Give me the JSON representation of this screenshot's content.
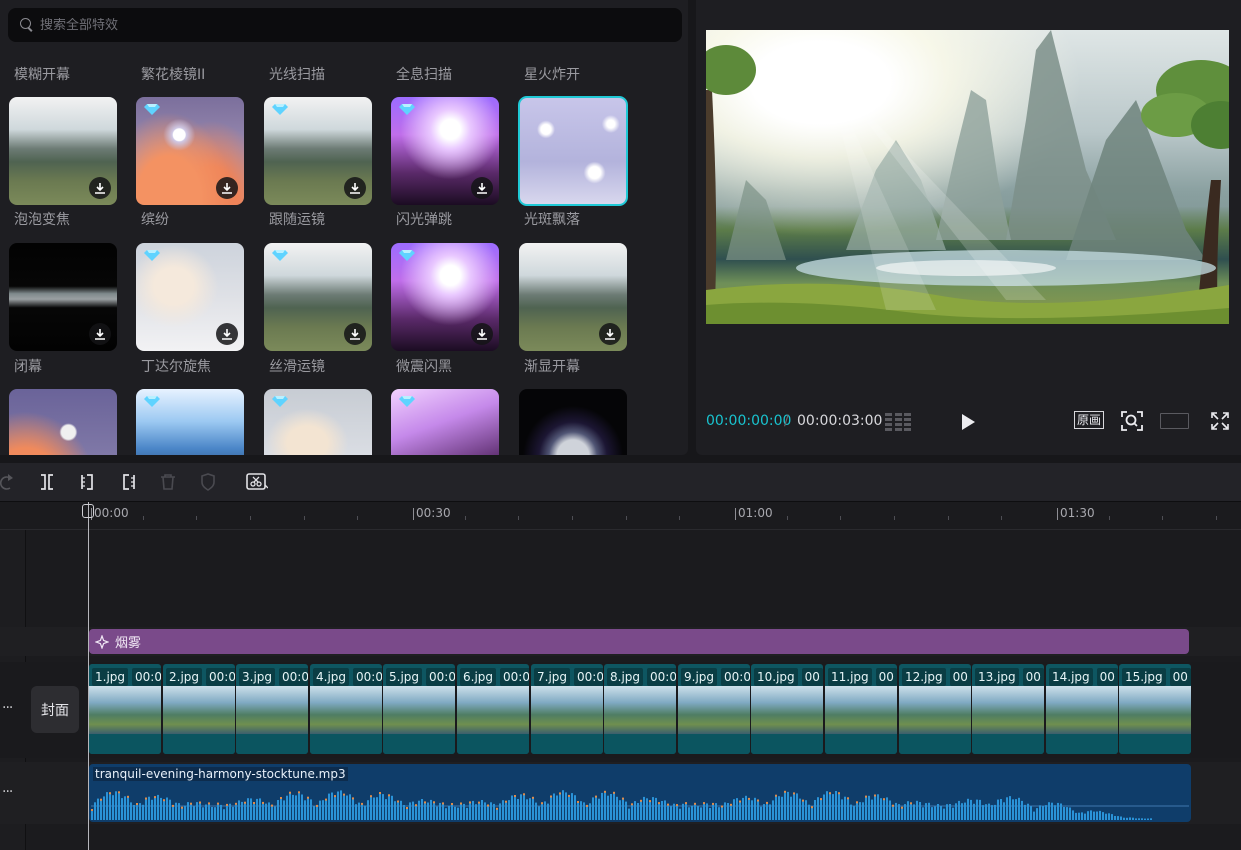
{
  "search": {
    "placeholder": "搜索全部特效"
  },
  "effects": {
    "row_labels_top": [
      "模糊开幕",
      "繁花棱镜II",
      "光线扫描",
      "全息扫描",
      "星火炸开"
    ],
    "rows": [
      [
        {
          "label": "泡泡变焦",
          "theme": "th-deer",
          "premium": false,
          "selected": false
        },
        {
          "label": "缤纷",
          "theme": "th-cloud",
          "premium": true,
          "selected": false
        },
        {
          "label": "跟随运镜",
          "theme": "th-deer",
          "premium": true,
          "selected": false
        },
        {
          "label": "闪光弹跳",
          "theme": "th-concert",
          "premium": true,
          "selected": false
        },
        {
          "label": "光斑飘落",
          "theme": "th-girl",
          "premium": false,
          "selected": true
        }
      ],
      [
        {
          "label": "闭幕",
          "theme": "th-black",
          "premium": false,
          "selected": false
        },
        {
          "label": "丁达尔旋焦",
          "theme": "th-boy",
          "premium": true,
          "selected": false
        },
        {
          "label": "丝滑运镜",
          "theme": "th-deer",
          "premium": true,
          "selected": false
        },
        {
          "label": "微震闪黑",
          "theme": "th-concert",
          "premium": true,
          "selected": false
        },
        {
          "label": "渐显开幕",
          "theme": "th-deer",
          "premium": false,
          "selected": false
        }
      ],
      [
        {
          "label": "",
          "theme": "th-moon",
          "premium": false,
          "selected": false
        },
        {
          "label": "",
          "theme": "th-sky",
          "premium": true,
          "selected": false
        },
        {
          "label": "",
          "theme": "th-boy2",
          "premium": true,
          "selected": false
        },
        {
          "label": "",
          "theme": "th-concert2",
          "premium": true,
          "selected": false
        },
        {
          "label": "",
          "theme": "th-orb",
          "premium": false,
          "selected": false
        }
      ]
    ]
  },
  "preview": {
    "current_time": "00:00:00:00",
    "separator": "/",
    "total_time": "00:00:03:00",
    "ratio_label": "原画"
  },
  "timeline": {
    "ruler": [
      "00:00",
      "00:30",
      "01:00",
      "01:30"
    ],
    "effect_clip": "烟雾",
    "cover_label": "封面",
    "more": "···",
    "clips": [
      {
        "name": "1.jpg",
        "time": "00:0"
      },
      {
        "name": "2.jpg",
        "time": "00:0"
      },
      {
        "name": "3.jpg",
        "time": "00:0"
      },
      {
        "name": "4.jpg",
        "time": "00:0"
      },
      {
        "name": "5.jpg",
        "time": "00:0"
      },
      {
        "name": "6.jpg",
        "time": "00:0"
      },
      {
        "name": "7.jpg",
        "time": "00:0"
      },
      {
        "name": "8.jpg",
        "time": "00:0"
      },
      {
        "name": "9.jpg",
        "time": "00:0"
      },
      {
        "name": "10.jpg",
        "time": "00"
      },
      {
        "name": "11.jpg",
        "time": "00"
      },
      {
        "name": "12.jpg",
        "time": "00"
      },
      {
        "name": "13.jpg",
        "time": "00"
      },
      {
        "name": "14.jpg",
        "time": "00"
      },
      {
        "name": "15.jpg",
        "time": "00"
      }
    ],
    "audio_name": "tranquil-evening-harmony-stocktune.mp3"
  },
  "colors": {
    "accent": "#19c3cf",
    "effect_track": "#7a4a8a",
    "video_track": "#0e5661",
    "audio_track": "#0f3d6a"
  }
}
